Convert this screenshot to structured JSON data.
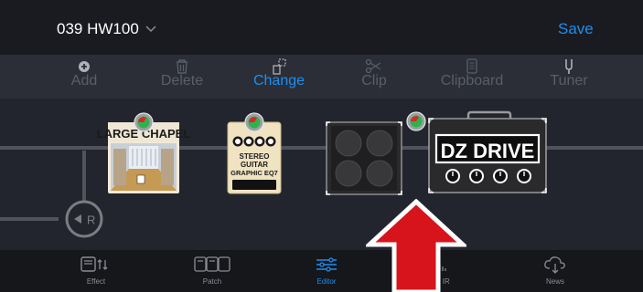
{
  "header": {
    "preset_name": "039 HW100",
    "save_label": "Save"
  },
  "toolbar": {
    "add": "Add",
    "delete": "Delete",
    "change": "Change",
    "clip": "Clip",
    "clipboard": "Clipboard",
    "tuner": "Tuner"
  },
  "chain": {
    "reverb_label": "LARGE CHAPEL",
    "eq_label_1": "STEREO",
    "eq_label_2": "GUITAR",
    "eq_label_3": "GRAPHIC EQ7",
    "amp_label": "DZ DRIVE",
    "return_label": "R"
  },
  "tabs": {
    "effect": "Effect",
    "patch": "Patch",
    "editor": "Editor",
    "import_ir": "ort IR",
    "news": "News"
  },
  "colors": {
    "accent": "#1e8ef0",
    "arrow": "#d7141c",
    "background": "#22252d"
  }
}
